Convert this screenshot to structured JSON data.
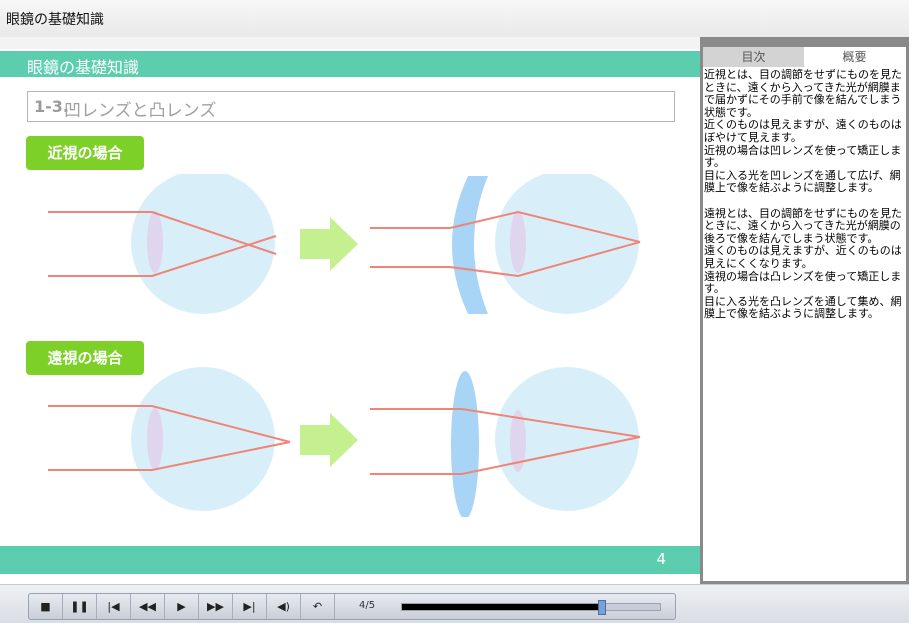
{
  "window": {
    "title": "眼鏡の基礎知識"
  },
  "slide": {
    "header": "眼鏡の基礎知識",
    "section_number": "1-3.",
    "section_title": "凹レンズと凸レンズ",
    "myopia_label": "近視の場合",
    "hyperopia_label": "遠視の場合",
    "page_number": "4"
  },
  "side_panel": {
    "tabs": {
      "toc": "目次",
      "summary": "概要"
    },
    "summary_paragraphs": [
      "近視とは、目の調節をせずにものを見たときに、遠くから入ってきた光が網膜まで届かずにその手前で像を結んでしまう状態です。",
      "近くのものは見えますが、遠くのものはぼやけて見えます。",
      "近視の場合は凹レンズを使って矯正します。",
      "目に入る光を凹レンズを通して広げ、網膜上で像を結ぶように調整します。",
      "",
      "遠視とは、目の調節をせずにものを見たときに、遠くから入ってきた光が網膜の後ろで像を結んでしまう状態です。",
      "遠くのものは見えますが、近くのものは見えにくくなります。",
      "遠視の場合は凸レンズを使って矯正します。",
      "目に入る光を凸レンズを通して集め、網膜上で像を結ぶように調整します。"
    ]
  },
  "player": {
    "counter": "4/5",
    "progress": 0.77,
    "buttons": [
      "stop",
      "pause",
      "first",
      "rewind",
      "play",
      "fast-forward",
      "last",
      "volume",
      "replay"
    ]
  },
  "colors": {
    "teal": "#5dcdb0",
    "label_green": "#7dd027",
    "eye_fill": "#d8effa",
    "lens_fill": "#a8d4f5",
    "ray": "#ef8576",
    "arrow": "#c5f08f"
  }
}
